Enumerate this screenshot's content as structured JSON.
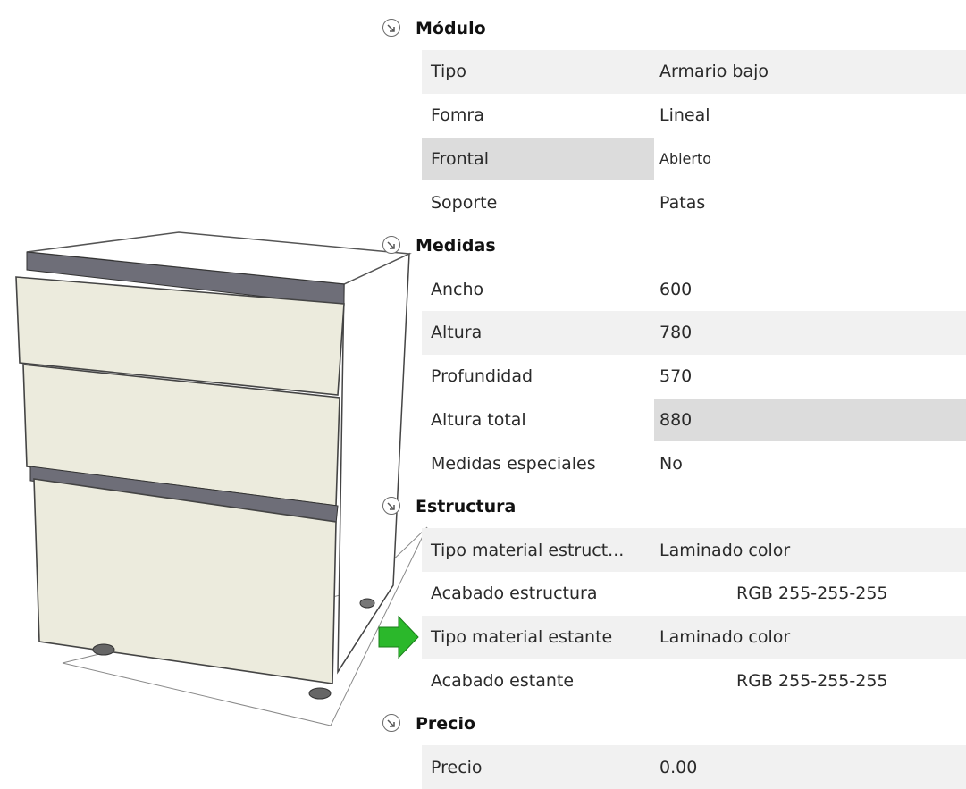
{
  "sections": [
    {
      "title": "Módulo",
      "rows": [
        {
          "label": "Tipo",
          "value": "Armario bajo"
        },
        {
          "label": "Fomra",
          "value": "Lineal"
        },
        {
          "label": "Frontal",
          "value": "Abierto"
        },
        {
          "label": "Soporte",
          "value": "Patas"
        }
      ]
    },
    {
      "title": "Medidas",
      "rows": [
        {
          "label": "Ancho",
          "value": "600"
        },
        {
          "label": "Altura",
          "value": "780"
        },
        {
          "label": "Profundidad",
          "value": "570"
        },
        {
          "label": "Altura total",
          "value": "880"
        },
        {
          "label": "Medidas especiales",
          "value": "No"
        }
      ]
    },
    {
      "title": "Estructura",
      "rows": [
        {
          "label": "Tipo material estruct...",
          "value": "Laminado color"
        },
        {
          "label": "Acabado estructura",
          "value": "RGB 255-255-255",
          "swatch": "#ffffff"
        },
        {
          "label": "Tipo material estante",
          "value": "Laminado color"
        },
        {
          "label": "Acabado estante",
          "value": "RGB 255-255-255",
          "swatch": "#ffffff"
        }
      ]
    },
    {
      "title": "Precio",
      "rows": [
        {
          "label": "Precio",
          "value": "0.00"
        }
      ]
    }
  ],
  "colors": {
    "row_alt": "#f1f1f1",
    "row_selected": "#dcdcdc",
    "cabinet_front": "#ecebdd",
    "cabinet_top_edge": "#6e6e78",
    "arrow": "#2bb82b"
  },
  "icons": {
    "section_toggle": "collapse-chevron-icon",
    "pointer": "green-arrow-icon"
  }
}
